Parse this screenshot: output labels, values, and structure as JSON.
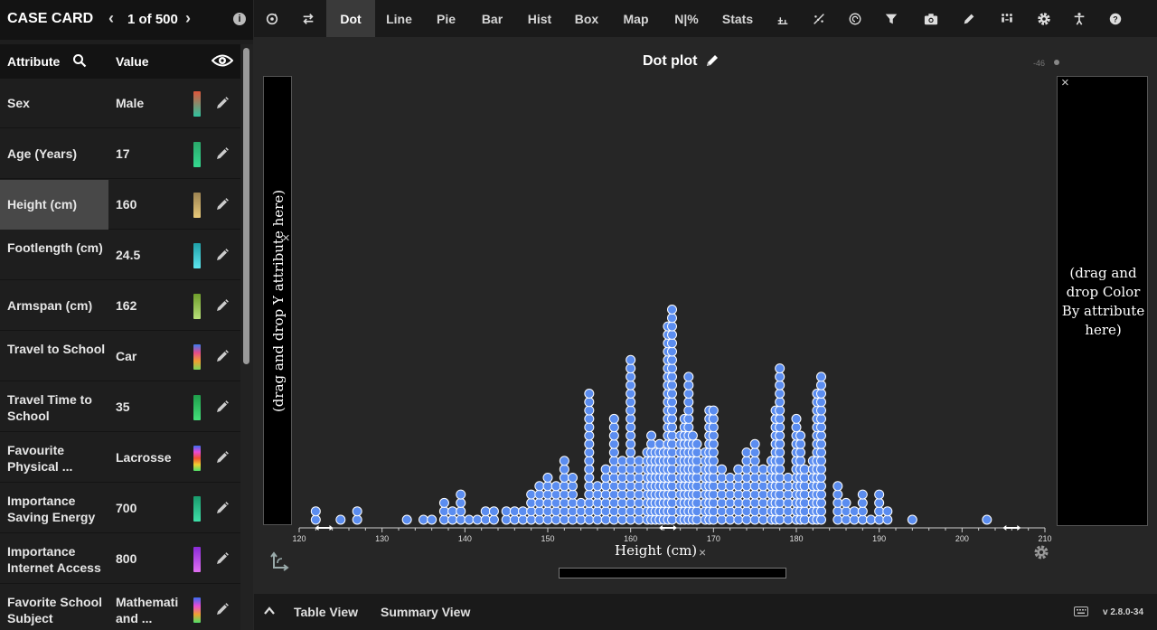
{
  "case_card": {
    "title": "CASE CARD",
    "counter": "1 of 500",
    "prev": "‹",
    "next": "›",
    "info": "i",
    "header_attr": "Attribute",
    "header_value": "Value",
    "rows": [
      {
        "attr": "Sex",
        "value": "Male",
        "swatch": [
          "#e0553a",
          "#2ec4a0"
        ]
      },
      {
        "attr": "Age (Years)",
        "value": "17",
        "swatch": [
          "#2aa86a",
          "#35d990"
        ]
      },
      {
        "attr": "Height (cm)",
        "value": "160",
        "swatch": [
          "#9d8452",
          "#e8c97a"
        ]
      },
      {
        "attr": "Footlength (cm)",
        "value": "24.5",
        "swatch": [
          "#1fa0a8",
          "#5ee6ef"
        ]
      },
      {
        "attr": "Armspan (cm)",
        "value": "162",
        "swatch": [
          "#6f9e2b",
          "#b8e07a"
        ]
      },
      {
        "attr": "Travel to School",
        "value": "Car",
        "swatch": [
          "#3a7cf0",
          "#e84b8a",
          "#f0a030",
          "#7bd65a"
        ]
      },
      {
        "attr": "Travel Time to School",
        "value": "35",
        "swatch": [
          "#1e9e4a",
          "#44e07a"
        ]
      },
      {
        "attr": "Favourite Physical ...",
        "value": "Lacrosse",
        "swatch": [
          "#3a6cf0",
          "#e84bd8",
          "#f05030",
          "#f0d030",
          "#4ee06a"
        ]
      },
      {
        "attr": "Importance Saving Energy",
        "value": "700",
        "swatch": [
          "#199a6c",
          "#3fe0a8"
        ]
      },
      {
        "attr": "Importance Internet Access",
        "value": "800",
        "swatch": [
          "#8a2ad8",
          "#e070f0"
        ]
      },
      {
        "attr": "Favorite School Subject",
        "value": "Mathemati and ...",
        "swatch": [
          "#3a6cf0",
          "#e84bd8",
          "#f0a030",
          "#4ee06a"
        ]
      }
    ],
    "selected_row": 2
  },
  "toolbar": {
    "items": [
      {
        "name": "rerandomize-button",
        "kind": "icon",
        "icon": "rerandomize-icon"
      },
      {
        "name": "swap-button",
        "kind": "icon",
        "icon": "swap-icon"
      },
      {
        "name": "dot-button",
        "kind": "text",
        "label": "Dot",
        "active": true
      },
      {
        "name": "line-button",
        "kind": "text",
        "label": "Line"
      },
      {
        "name": "pie-button",
        "kind": "text",
        "label": "Pie"
      },
      {
        "name": "bar-button",
        "kind": "text",
        "label": "Bar"
      },
      {
        "name": "hist-button",
        "kind": "text",
        "label": "Hist"
      },
      {
        "name": "box-button",
        "kind": "text",
        "label": "Box"
      },
      {
        "name": "map-button",
        "kind": "text",
        "label": "Map"
      },
      {
        "name": "count-percent-button",
        "kind": "text",
        "label": "N|%"
      },
      {
        "name": "stats-button",
        "kind": "text",
        "label": "Stats"
      },
      {
        "name": "split-button",
        "kind": "icon",
        "icon": "split-icon"
      },
      {
        "name": "trend-button",
        "kind": "icon",
        "icon": "trend-icon"
      },
      {
        "name": "spiral-button",
        "kind": "icon",
        "icon": "spiral-icon"
      },
      {
        "name": "filter-button",
        "kind": "icon",
        "icon": "filter-icon"
      },
      {
        "name": "camera-button",
        "kind": "icon",
        "icon": "camera-icon"
      },
      {
        "name": "draw-button",
        "kind": "icon",
        "icon": "pen-icon"
      },
      {
        "name": "groups-button",
        "kind": "icon",
        "icon": "groups-icon"
      },
      {
        "name": "settings-button",
        "kind": "icon",
        "icon": "gear-icon"
      },
      {
        "name": "accessibility-button",
        "kind": "icon",
        "icon": "accessibility-icon"
      },
      {
        "name": "help-button",
        "kind": "icon",
        "icon": "help-icon"
      }
    ]
  },
  "graph": {
    "title": "Dot plot",
    "corner_label": "-46",
    "y_drop": "(drag and drop Y attribute here)",
    "color_drop": "(drag and drop Color By attribute here)",
    "close": "×",
    "x_label": "Height (cm)"
  },
  "chart_data": {
    "type": "scatter",
    "subtype": "dot plot (stacked)",
    "xlabel": "Height (cm)",
    "xlim": [
      120,
      210
    ],
    "x_ticks": [
      120,
      130,
      140,
      150,
      160,
      170,
      180,
      190,
      200,
      210
    ],
    "dot_color": "#5b8df0",
    "dot_stroke": "#ffffff",
    "bins": [
      [
        122,
        2
      ],
      [
        125,
        1
      ],
      [
        127,
        2
      ],
      [
        133,
        1
      ],
      [
        135,
        1
      ],
      [
        136,
        1
      ],
      [
        137.5,
        3
      ],
      [
        138.5,
        2
      ],
      [
        139.5,
        4
      ],
      [
        140.5,
        1
      ],
      [
        141.5,
        1
      ],
      [
        142.5,
        2
      ],
      [
        143.5,
        2
      ],
      [
        145,
        2
      ],
      [
        146,
        2
      ],
      [
        147,
        2
      ],
      [
        148,
        4
      ],
      [
        149,
        5
      ],
      [
        150,
        6
      ],
      [
        151,
        5
      ],
      [
        152,
        8
      ],
      [
        153,
        6
      ],
      [
        154,
        3
      ],
      [
        155,
        16
      ],
      [
        156,
        5
      ],
      [
        157,
        7
      ],
      [
        158,
        13
      ],
      [
        159,
        8
      ],
      [
        160,
        20
      ],
      [
        161,
        8
      ],
      [
        162,
        9
      ],
      [
        162.5,
        11
      ],
      [
        163,
        9
      ],
      [
        163.5,
        10
      ],
      [
        164,
        9
      ],
      [
        164.5,
        24
      ],
      [
        165,
        26
      ],
      [
        166,
        11
      ],
      [
        166.5,
        13
      ],
      [
        167,
        18
      ],
      [
        167.5,
        11
      ],
      [
        168,
        10
      ],
      [
        169,
        9
      ],
      [
        169.5,
        14
      ],
      [
        170,
        14
      ],
      [
        171,
        7
      ],
      [
        172,
        6
      ],
      [
        173,
        7
      ],
      [
        174,
        9
      ],
      [
        175,
        10
      ],
      [
        176,
        7
      ],
      [
        177,
        8
      ],
      [
        177.5,
        14
      ],
      [
        178,
        19
      ],
      [
        179,
        6
      ],
      [
        180,
        13
      ],
      [
        180.5,
        11
      ],
      [
        181,
        7
      ],
      [
        182,
        8
      ],
      [
        182.5,
        16
      ],
      [
        183,
        18
      ],
      [
        185,
        5
      ],
      [
        186,
        3
      ],
      [
        187,
        2
      ],
      [
        188,
        4
      ],
      [
        189,
        1
      ],
      [
        190,
        4
      ],
      [
        191,
        2
      ],
      [
        194,
        1
      ],
      [
        203,
        1
      ]
    ]
  },
  "bottom": {
    "table_view": "Table View",
    "summary_view": "Summary View",
    "version": "v 2.8.0-34"
  }
}
